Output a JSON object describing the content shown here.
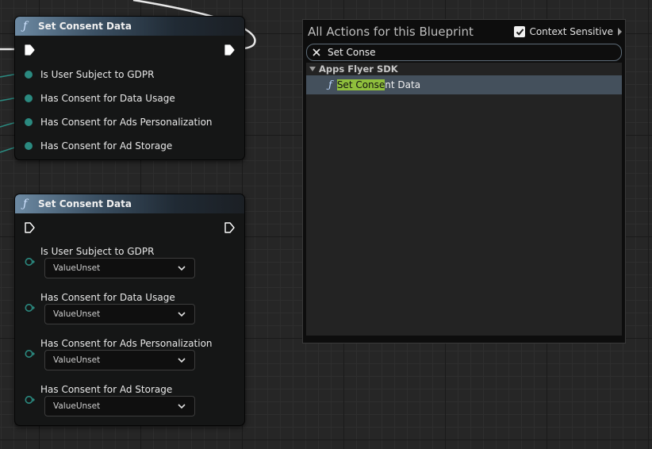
{
  "nodes": [
    {
      "title": "Set Consent Data",
      "icon": "function-icon",
      "pins": [
        "Is User Subject to GDPR",
        "Has Consent for Data Usage",
        "Has Consent for Ads Personalization",
        "Has Consent for Ad Storage"
      ]
    },
    {
      "title": "Set Consent Data",
      "icon": "function-icon",
      "fields": [
        {
          "label": "Is User Subject to GDPR",
          "value": "ValueUnset"
        },
        {
          "label": "Has Consent for Data Usage",
          "value": "ValueUnset"
        },
        {
          "label": "Has Consent for Ads Personalization",
          "value": "ValueUnset"
        },
        {
          "label": "Has Consent for Ad Storage",
          "value": "ValueUnset"
        }
      ]
    }
  ],
  "action_menu": {
    "title": "All Actions for this Blueprint",
    "context_sensitive_label": "Context Sensitive",
    "context_sensitive_checked": true,
    "search_value": "Set Conse",
    "category": "Apps Flyer SDK",
    "result": {
      "highlight": "Set Conse",
      "rest": "nt Data"
    }
  },
  "colors": {
    "pin_teal": "#2b8a80",
    "highlight": "#8fbf3c",
    "selected_row": "#44505c"
  }
}
